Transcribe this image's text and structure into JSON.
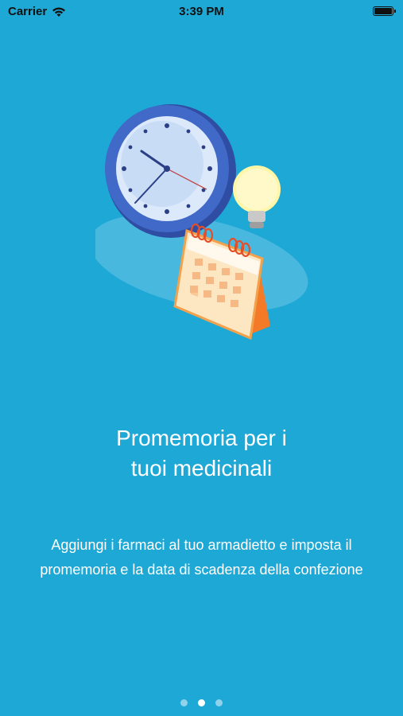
{
  "status_bar": {
    "carrier": "Carrier",
    "time": "3:39 PM"
  },
  "onboarding": {
    "title": "Promemoria per i\ntuoi medicinali",
    "description": "Aggiungi i farmaci al tuo armadietto e imposta il promemoria e la data di scadenza della confezione",
    "page_indicator": {
      "current": 2,
      "total": 3
    }
  },
  "colors": {
    "background": "#1ea8d6",
    "clock_rim": "#3b5fb5",
    "calendar_accent": "#f47a28",
    "bulb": "#fff27a"
  },
  "icons": [
    "wifi-icon",
    "battery-icon",
    "clock-icon",
    "lightbulb-icon",
    "calendar-icon"
  ]
}
